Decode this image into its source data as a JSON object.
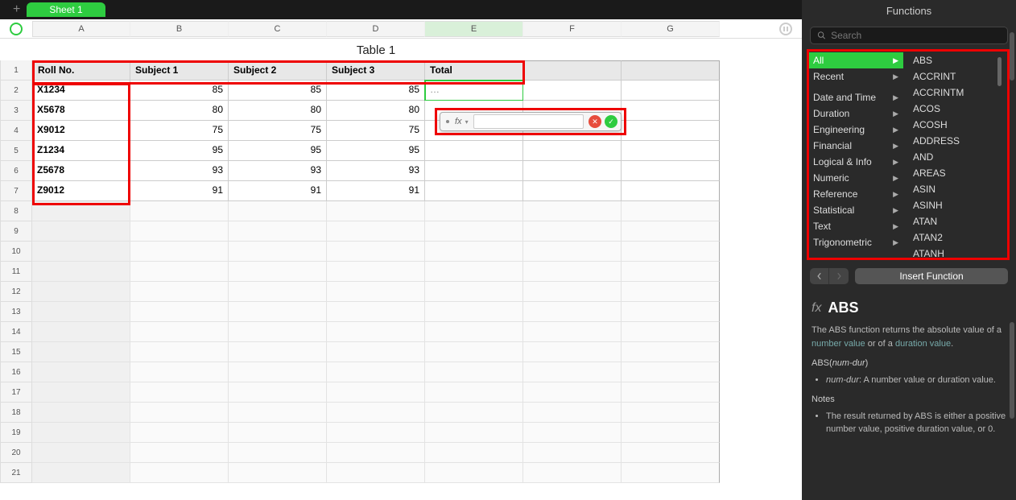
{
  "tabs": {
    "sheet1": "Sheet 1"
  },
  "columns": [
    "A",
    "B",
    "C",
    "D",
    "E",
    "F",
    "G"
  ],
  "table": {
    "title": "Table 1",
    "headers": {
      "a": "Roll No.",
      "b": "Subject 1",
      "c": "Subject 2",
      "d": "Subject 3",
      "e": "Total"
    },
    "rows": [
      {
        "a": "X1234",
        "b": "85",
        "c": "85",
        "d": "85",
        "e": "…"
      },
      {
        "a": "X5678",
        "b": "80",
        "c": "80",
        "d": "80",
        "e": ""
      },
      {
        "a": "X9012",
        "b": "75",
        "c": "75",
        "d": "75",
        "e": ""
      },
      {
        "a": "Z1234",
        "b": "95",
        "c": "95",
        "d": "95",
        "e": ""
      },
      {
        "a": "Z5678",
        "b": "93",
        "c": "93",
        "d": "93",
        "e": ""
      },
      {
        "a": "Z9012",
        "b": "91",
        "c": "91",
        "d": "91",
        "e": ""
      }
    ]
  },
  "row_labels": [
    "1",
    "2",
    "3",
    "4",
    "5",
    "6",
    "7",
    "8",
    "9",
    "10",
    "11",
    "12",
    "13",
    "14",
    "15",
    "16",
    "17",
    "18",
    "19",
    "20",
    "21"
  ],
  "formula": {
    "fx_label": "fx",
    "value": ""
  },
  "sidebar": {
    "title": "Functions",
    "search_placeholder": "Search",
    "categories": [
      "All",
      "Recent",
      "",
      "Date and Time",
      "Duration",
      "Engineering",
      "Financial",
      "Logical & Info",
      "Numeric",
      "Reference",
      "Statistical",
      "Text",
      "Trigonometric"
    ],
    "functions": [
      "ABS",
      "ACCRINT",
      "ACCRINTM",
      "ACOS",
      "ACOSH",
      "ADDRESS",
      "AND",
      "AREAS",
      "ASIN",
      "ASINH",
      "ATAN",
      "ATAN2",
      "ATANH"
    ],
    "insert_label": "Insert Function",
    "detail": {
      "name": "ABS",
      "summary_pre": "The ABS function returns the absolute value of a ",
      "summary_link1": "number value",
      "summary_mid": " or of a ",
      "summary_link2": "duration value",
      "summary_post": ".",
      "signature_pre": "ABS(",
      "signature_arg": "num-dur",
      "signature_post": ")",
      "arg_name": "num-dur",
      "arg_desc": ": A number value or duration value.",
      "notes_heading": "Notes",
      "note1": "The result returned by ABS is either a positive number value, positive duration value, or 0."
    }
  }
}
